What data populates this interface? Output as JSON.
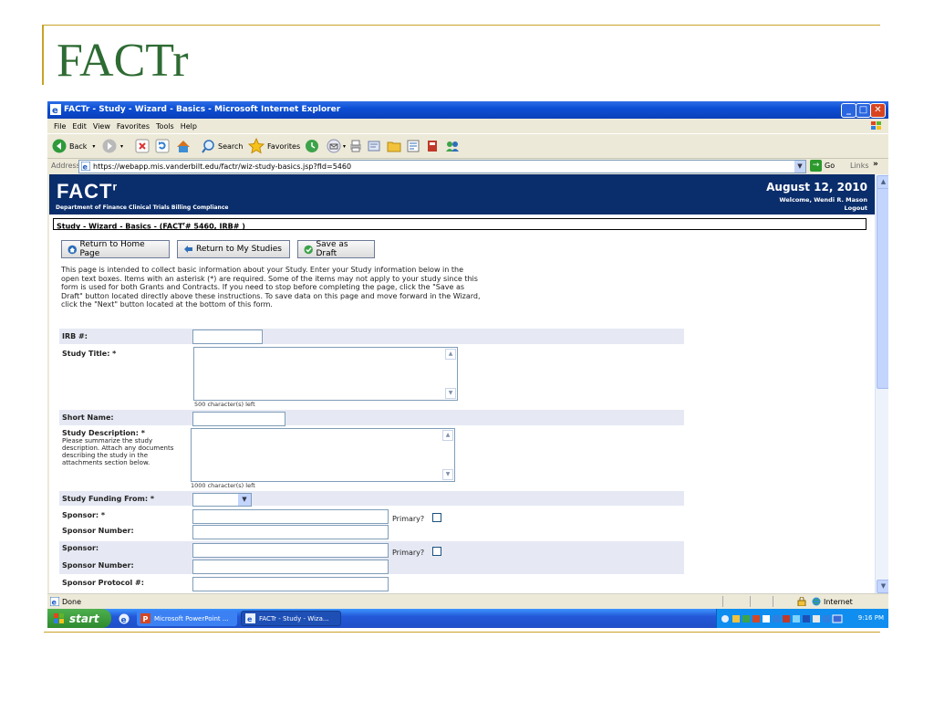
{
  "slide": {
    "title": "FACTr"
  },
  "window": {
    "title": "FACTr - Study - Wizard - Basics - Microsoft Internet Explorer",
    "menu": [
      "File",
      "Edit",
      "View",
      "Favorites",
      "Tools",
      "Help"
    ],
    "toolbar": {
      "back": "Back",
      "search": "Search",
      "favorites": "Favorites"
    },
    "address": {
      "label": "Address",
      "url": "https://webapp.mis.vanderbilt.edu/factr/wiz-study-basics.jsp?fId=5460",
      "go": "Go",
      "links": "Links",
      "links_chevron": "»"
    }
  },
  "page": {
    "logo": "FACT",
    "logo_sup": "r",
    "department": "Department of Finance Clinical Trials Billing Compliance",
    "date": "August 12, 2010",
    "welcome": "Welcome, Wendi R. Mason",
    "logout": "Logout",
    "breadcrumb_pre": "Study - Wizard - Basics - (FACT",
    "breadcrumb_sup": "r",
    "breadcrumb_post": "# 5460, IRB# )",
    "buttons": {
      "home": "Return to Home Page",
      "studies": "Return to My Studies",
      "draft": "Save as Draft"
    },
    "intro": "This page is intended to collect basic information about your Study. Enter your Study information below in the open text boxes. Items with an asterisk (*) are required. Some of the items may not apply to your study since this form is used for both Grants and Contracts. If you need to stop before completing the page, click the \"Save as Draft\" button located directly above these instructions. To save data on this page and move forward in the Wizard, click the \"Next\" button located at the bottom of this form.",
    "form": {
      "irb": "IRB #:",
      "study_title": "Study Title: *",
      "title_counter": "500 character(s) left",
      "short_name": "Short Name:",
      "study_desc": "Study Description: *",
      "study_desc_help": "Please summarize the study description. Attach any documents describing the study in the attachments section below.",
      "desc_counter": "1000 character(s) left",
      "funding": "Study Funding From: *",
      "sponsor1": "Sponsor: *",
      "sponsor_number1": "Sponsor Number:",
      "sponsor2": "Sponsor:",
      "sponsor_number2": "Sponsor Number:",
      "protocol": "Sponsor Protocol #:",
      "primary": "Primary?"
    }
  },
  "status": {
    "done": "Done",
    "zone": "Internet"
  },
  "taskbar": {
    "start": "start",
    "tasks": [
      "Microsoft PowerPoint ...",
      "FACTr - Study - Wiza..."
    ],
    "clock": "9:16 PM"
  }
}
